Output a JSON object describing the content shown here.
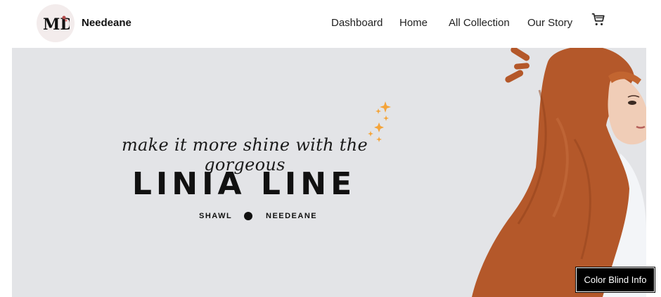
{
  "brand": {
    "name": "Needeane",
    "logo_letters": "MD"
  },
  "nav": {
    "items": [
      {
        "label": "Dashboard"
      },
      {
        "label": "Home"
      },
      {
        "label": "All Collection"
      },
      {
        "label": "Our Story"
      }
    ],
    "cart_icon": "cart-icon"
  },
  "hero": {
    "tagline": "make it more shine with the gorgeous",
    "title": "LINIA LINE",
    "sub_left": "SHAWL",
    "sub_right": "NEEDEANE",
    "colors": {
      "background": "#e3e4e7",
      "hijab": "#b4582a",
      "sparkle": "#f4a43a"
    }
  },
  "accessibility": {
    "color_blind_label": "Color Blind Info"
  }
}
